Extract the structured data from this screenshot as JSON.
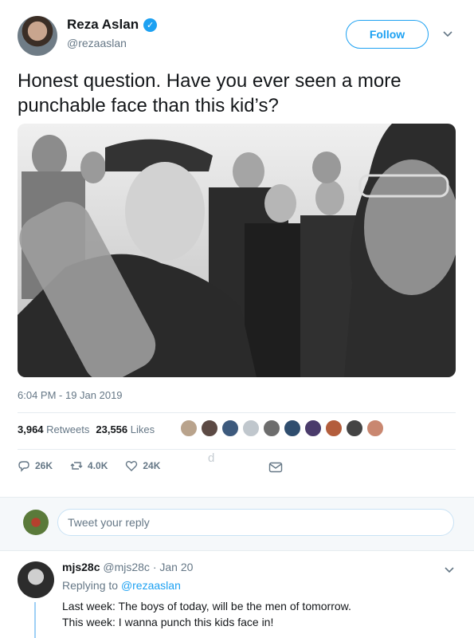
{
  "header": {
    "display_name": "Reza Aslan",
    "handle": "@rezaaslan",
    "follow_label": "Follow"
  },
  "tweet": {
    "text": "Honest question. Have you ever seen a more punchable face than this kid’s?",
    "timestamp": "6:04 PM - 19 Jan 2019",
    "retweets_count": "3,964",
    "retweets_label": "Retweets",
    "likes_count": "23,556",
    "likes_label": "Likes",
    "actions": {
      "reply_count": "26K",
      "retweet_count": "4.0K",
      "like_count": "24K"
    },
    "stray_glyph": "d"
  },
  "reply_box": {
    "placeholder": "Tweet your reply"
  },
  "reply": {
    "name": "mjs28c",
    "handle": "@mjs28c",
    "dot": "·",
    "date": "Jan 20",
    "replying_prefix": "Replying to",
    "replying_to": "@rezaaslan",
    "line1": "Last week: The boys of today, will be the men of tomorrow.",
    "line2": "This week: I wanna punch this kids face in!"
  },
  "colors": {
    "accent": "#1da1f2",
    "secondary_text": "#657786",
    "primary_text": "#14171a"
  },
  "likers": [
    "#b9a38c",
    "#5c4a44",
    "#3d5a7d",
    "#c0c7cd",
    "#6d6d6d",
    "#2f4d6e",
    "#4a3b6b",
    "#b35d3c",
    "#444444",
    "#c98770"
  ]
}
